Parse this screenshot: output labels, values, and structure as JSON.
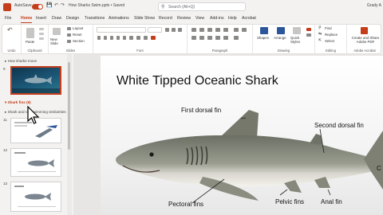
{
  "titlebar": {
    "autosave_label": "AutoSave",
    "filename": "How Sharks Swim.pptx • Saved",
    "search_placeholder": "Search (Alt+Q)",
    "user": "Grady A"
  },
  "tabs": [
    "File",
    "Home",
    "Insert",
    "Draw",
    "Design",
    "Transitions",
    "Animations",
    "Slide Show",
    "Record",
    "Review",
    "View",
    "Add-ins",
    "Help",
    "Acrobat"
  ],
  "ribbon": {
    "groups": {
      "undo": "Undo",
      "clipboard": "Clipboard",
      "slides": "Slides",
      "font": "Font",
      "paragraph": "Paragraph",
      "drawing": "Drawing",
      "editing": "Editing",
      "adobe": "Adobe Acrobat"
    },
    "clipboard": {
      "paste": "Paste"
    },
    "slides": {
      "new_slide": "New Slide",
      "layout": "Layout",
      "reset": "Reset",
      "section": "Section"
    },
    "drawing": {
      "shapes": "Shapes",
      "arrange": "Arrange",
      "quick_styles": "Quick Styles"
    },
    "editing": {
      "find": "Find",
      "replace": "Replace",
      "select": "Select"
    },
    "adobe": {
      "create_share": "Create and Share Adobe PDF"
    }
  },
  "left_panel": {
    "section1": "How sharks move",
    "section2": "Shark fins (9)",
    "section3": "Shark and ray swimming similarities",
    "slide_numbers": [
      "9",
      "11",
      "12",
      "13"
    ]
  },
  "slide": {
    "title": "White Tipped Oceanic Shark",
    "labels": {
      "first_dorsal": "First dorsal fin",
      "second_dorsal": "Second dorsal fin",
      "pectoral": "Pectoral fins",
      "pelvic": "Pelvic fins",
      "anal": "Anal fin",
      "caudal_partial": "C"
    }
  },
  "colors": {
    "accent": "#c43e1c",
    "ribbon_bg": "#ffffff",
    "panel_bg": "#f3f2f1"
  }
}
